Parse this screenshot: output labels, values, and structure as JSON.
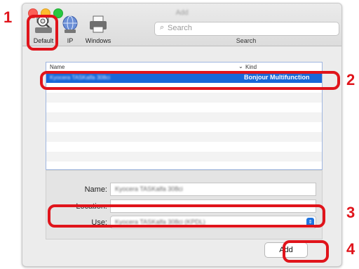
{
  "steps": [
    "1",
    "2",
    "3",
    "4"
  ],
  "window": {
    "title": "Add",
    "toolbar": {
      "default_label": "Default",
      "ip_label": "IP",
      "windows_label": "Windows",
      "search_placeholder": "Search",
      "search_label": "Search"
    },
    "list": {
      "col_name": "Name",
      "col_kind": "Kind",
      "selected_row": {
        "name": "Kyocera TASKalfa 308ci",
        "kind": "Bonjour Multifunction"
      }
    },
    "form": {
      "name_label": "Name:",
      "name_value": "Kyocera TASKalfa 308ci",
      "location_label": "Location:",
      "location_value": "",
      "use_label": "Use:",
      "use_value": "Kyocera TASKalfa 308ci (KPDL)"
    },
    "add_button": "Add"
  },
  "colors": {
    "highlight": "#e0141b",
    "selection": "#1868d8"
  }
}
